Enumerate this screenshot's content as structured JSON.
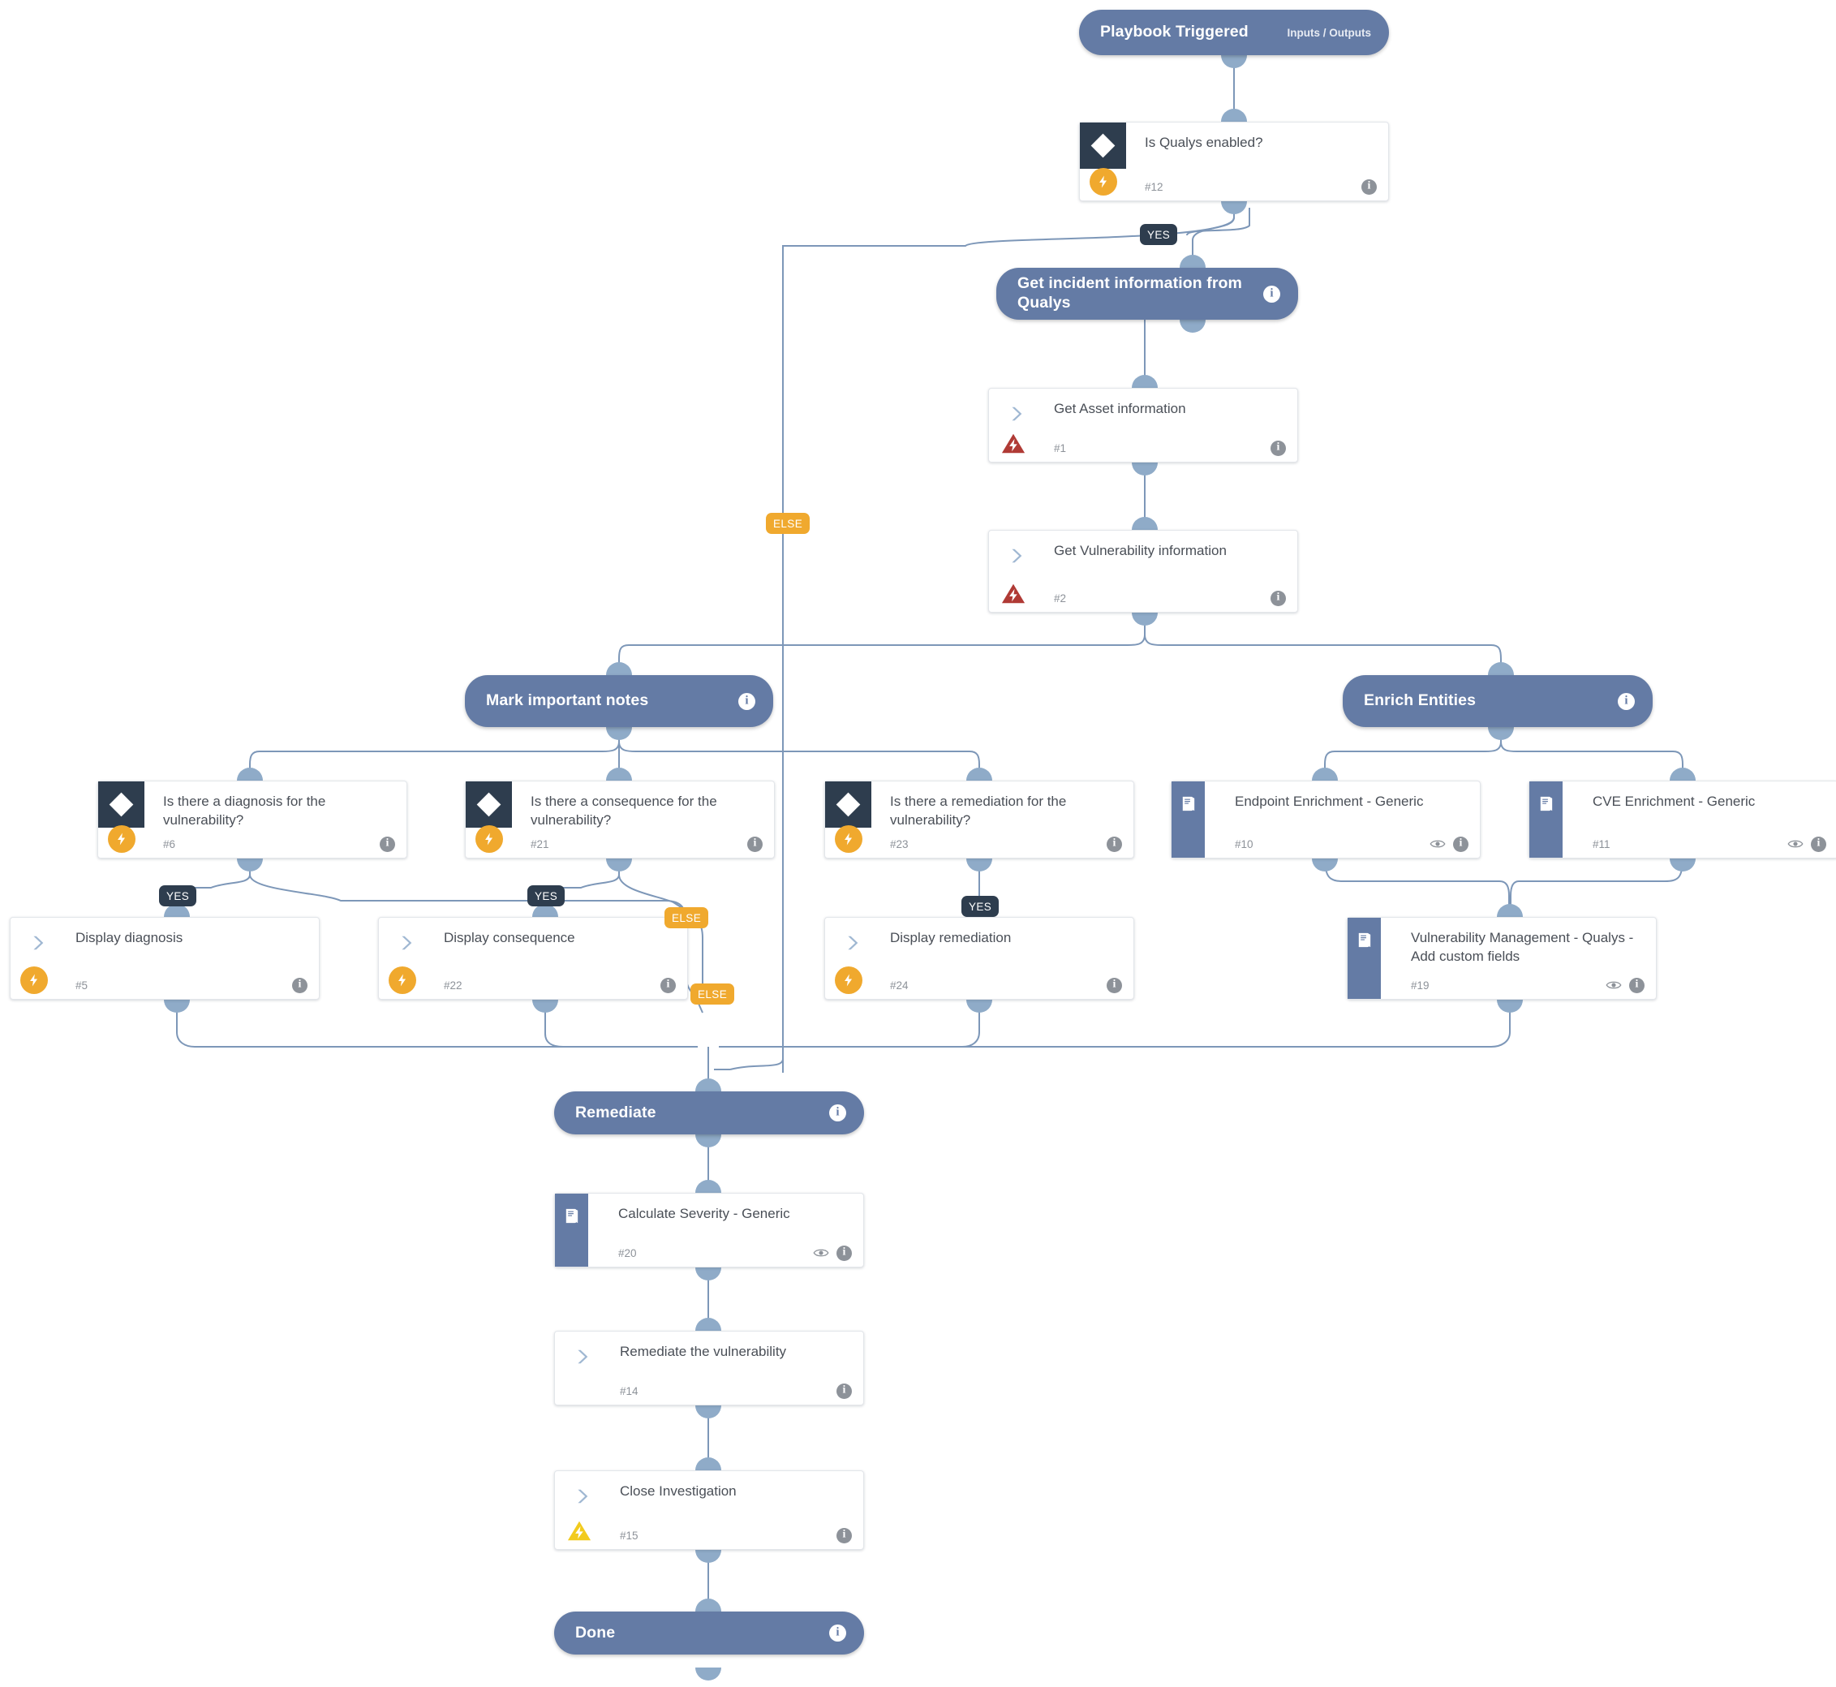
{
  "colors": {
    "section_fill": "#647ba5",
    "card_bg": "#ffffff",
    "decision_icon_bg": "#2e3d4e",
    "yes_label_bg": "#2e3d4e",
    "else_label_bg": "#f0a92e",
    "trigger_badge": "#f0a92e",
    "error_badge": "#b03a35",
    "warning_badge": "#f2cb1d",
    "edge_line": "#7d97b8",
    "canvas_bg": "#ffffff"
  },
  "sections": {
    "playbook_triggered": {
      "title": "Playbook Triggered",
      "sub": "Inputs / Outputs"
    },
    "get_incident": {
      "title": "Get incident information from Qualys"
    },
    "mark_notes": {
      "title": "Mark important notes"
    },
    "enrich_entities": {
      "title": "Enrich Entities"
    },
    "remediate": {
      "title": "Remediate"
    },
    "done": {
      "title": "Done"
    }
  },
  "tasks": {
    "is_qualys_enabled": {
      "title": "Is Qualys enabled?",
      "id": "#12",
      "icon": "diamond-icon",
      "badge": "trigger-bolt-icon"
    },
    "get_asset_information": {
      "title": "Get Asset information",
      "id": "#1",
      "icon": "chevron-right-icon",
      "badge": "error-bolt-icon"
    },
    "get_vulnerability_information": {
      "title": "Get Vulnerability information",
      "id": "#2",
      "icon": "chevron-right-icon",
      "badge": "error-bolt-icon"
    },
    "is_there_diagnosis": {
      "title": "Is there a diagnosis for the vulnerability?",
      "id": "#6",
      "icon": "diamond-icon",
      "badge": "trigger-bolt-icon"
    },
    "is_there_consequence": {
      "title": "Is there a consequence for the vulnerability?",
      "id": "#21",
      "icon": "diamond-icon",
      "badge": "trigger-bolt-icon"
    },
    "is_there_remediation": {
      "title": "Is there a remediation for the vulnerability?",
      "id": "#23",
      "icon": "diamond-icon",
      "badge": "trigger-bolt-icon"
    },
    "endpoint_enrichment": {
      "title": "Endpoint Enrichment - Generic",
      "id": "#10",
      "icon": "playbook-book-icon",
      "badge": null
    },
    "cve_enrichment": {
      "title": "CVE Enrichment - Generic",
      "id": "#11",
      "icon": "playbook-book-icon",
      "badge": null
    },
    "display_diagnosis": {
      "title": "Display diagnosis",
      "id": "#5",
      "icon": "chevron-right-icon",
      "badge": "trigger-bolt-icon"
    },
    "display_consequence": {
      "title": "Display consequence",
      "id": "#22",
      "icon": "chevron-right-icon",
      "badge": "trigger-bolt-icon"
    },
    "display_remediation": {
      "title": "Display remediation",
      "id": "#24",
      "icon": "chevron-right-icon",
      "badge": "trigger-bolt-icon"
    },
    "vuln_mgmt_add_fields": {
      "title": "Vulnerability Management - Qualys - Add custom fields",
      "id": "#19",
      "icon": "playbook-book-icon",
      "badge": null
    },
    "calculate_severity": {
      "title": "Calculate Severity - Generic",
      "id": "#20",
      "icon": "playbook-book-icon",
      "badge": null
    },
    "remediate_the_vulnerability": {
      "title": "Remediate the vulnerability",
      "id": "#14",
      "icon": "chevron-right-icon",
      "badge": null
    },
    "close_investigation": {
      "title": "Close Investigation",
      "id": "#15",
      "icon": "chevron-right-icon",
      "badge": "warning-bolt-icon"
    }
  },
  "branch_labels": {
    "qualys_yes": "YES",
    "qualys_else": "ELSE",
    "diagnosis_yes": "YES",
    "consequence_yes": "YES",
    "consequence_else": "ELSE",
    "diagnosis_else": "ELSE",
    "remediation_yes": "YES"
  }
}
